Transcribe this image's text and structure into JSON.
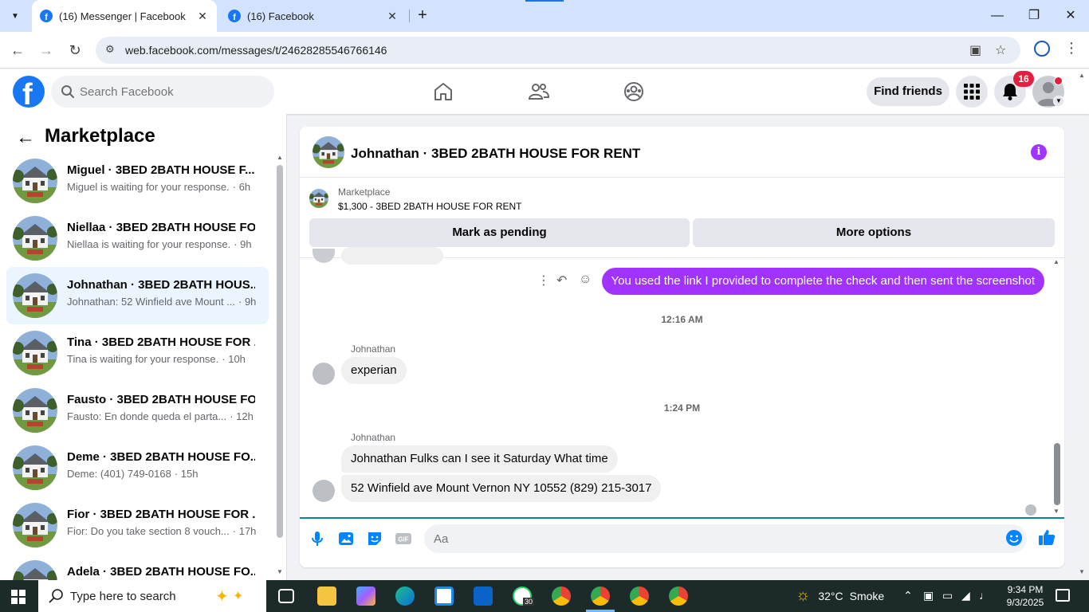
{
  "browser": {
    "tabs": [
      {
        "title": "(16) Messenger | Facebook",
        "active": true
      },
      {
        "title": "(16) Facebook",
        "active": false
      }
    ],
    "url": "web.facebook.com/messages/t/24628285546766146"
  },
  "header": {
    "search_placeholder": "Search Facebook",
    "find_friends": "Find friends",
    "notification_count": "16",
    "icons": [
      "home-icon",
      "friends-icon",
      "groups-icon",
      "menu-grid-icon",
      "bell-icon"
    ]
  },
  "sidebar": {
    "title": "Marketplace",
    "conversations": [
      {
        "name": "Miguel · 3BED 2BATH HOUSE F...",
        "preview": "Miguel is waiting for your response.",
        "time": "· 6h",
        "selected": false
      },
      {
        "name": "Niellaa · 3BED 2BATH HOUSE FO...",
        "preview": "Niellaa is waiting for your response.",
        "time": "· 9h",
        "selected": false
      },
      {
        "name": "Johnathan · 3BED 2BATH HOUS...",
        "preview": "Johnathan: 52 Winfield ave Mount ...",
        "time": "· 9h",
        "selected": true
      },
      {
        "name": "Tina · 3BED 2BATH HOUSE FOR ...",
        "preview": "Tina is waiting for your response.",
        "time": "· 10h",
        "selected": false
      },
      {
        "name": "Fausto · 3BED 2BATH HOUSE FO...",
        "preview": "Fausto: En donde queda el parta...",
        "time": "· 12h",
        "selected": false
      },
      {
        "name": "Deme · 3BED 2BATH HOUSE FO...",
        "preview": "Deme: (401) 749-0168",
        "time": "· 15h",
        "selected": false
      },
      {
        "name": "Fior · 3BED 2BATH HOUSE FOR ...",
        "preview": "Fior: Do you take section 8 vouch...",
        "time": "· 17h",
        "selected": false
      },
      {
        "name": "Adela · 3BED 2BATH HOUSE FO...",
        "preview": "",
        "time": "",
        "selected": false
      }
    ]
  },
  "chat": {
    "title": "Johnathan · 3BED 2BATH HOUSE FOR RENT",
    "marketplace_label": "Marketplace",
    "listing": "$1,300 - 3BED 2BATH HOUSE FOR RENT",
    "mark_pending": "Mark as pending",
    "more_options": "More options",
    "outgoing_message": "You used the link I provided to complete the check and then sent the screenshot",
    "time_1": "12:16 AM",
    "sender_1": "Johnathan",
    "message_1": "experian",
    "time_2": "1:24 PM",
    "sender_2": "Johnathan",
    "message_2": "Johnathan Fulks can I see it Saturday What time",
    "message_3": "52 Winfield ave Mount Vernon NY 10552  (829) 215-3017",
    "composer_placeholder": "Aa",
    "accent_color": "#a033ff"
  },
  "taskbar": {
    "search_text": "Type here to search",
    "weather_temp": "32°C",
    "weather_desc": "Smoke",
    "time": "9:34 PM",
    "date": "9/3/2025",
    "whatsapp_badge": "30"
  }
}
